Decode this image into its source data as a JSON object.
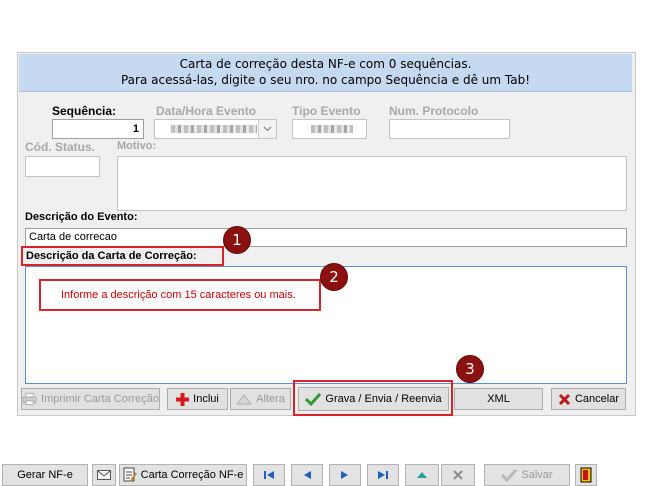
{
  "banner": {
    "line1": "Carta de correção desta NF-e com 0 sequências.",
    "line2": "Para acessá-las, digite o seu nro. no campo Sequência e dê um Tab!"
  },
  "form": {
    "sequencia_label": "Sequência:",
    "sequencia_value": "1",
    "data_hora_label": "Data/Hora Evento",
    "tipo_evento_label": "Tipo Evento",
    "num_protocolo_label": "Num. Protocolo",
    "cod_status_label": "Cód. Status.",
    "motivo_label": "Motivo:",
    "descricao_evento_label": "Descrição do Evento:",
    "descricao_evento_value": "Carta de correcao",
    "descricao_carta_label": "Descrição da Carta de Correção:",
    "hint": "Informe a descrição com 15 caracteres ou mais."
  },
  "buttons": {
    "imprimir": "Imprimir Carta Correção",
    "inclui": "Inclui",
    "altera": "Altera",
    "grava": "Grava / Envia / Reenvia",
    "xml": "XML",
    "cancelar": "Cancelar"
  },
  "badges": {
    "one": "1",
    "two": "2",
    "three": "3"
  },
  "toolbar": {
    "gerar": "Gerar NF-e",
    "carta": "Carta Correção NF-e",
    "salvar": "Salvar"
  },
  "colors": {
    "banner": "#c5d9f1",
    "highlight": "#d8232a",
    "badge": "#8b1111",
    "hint_text": "#cc0000"
  }
}
